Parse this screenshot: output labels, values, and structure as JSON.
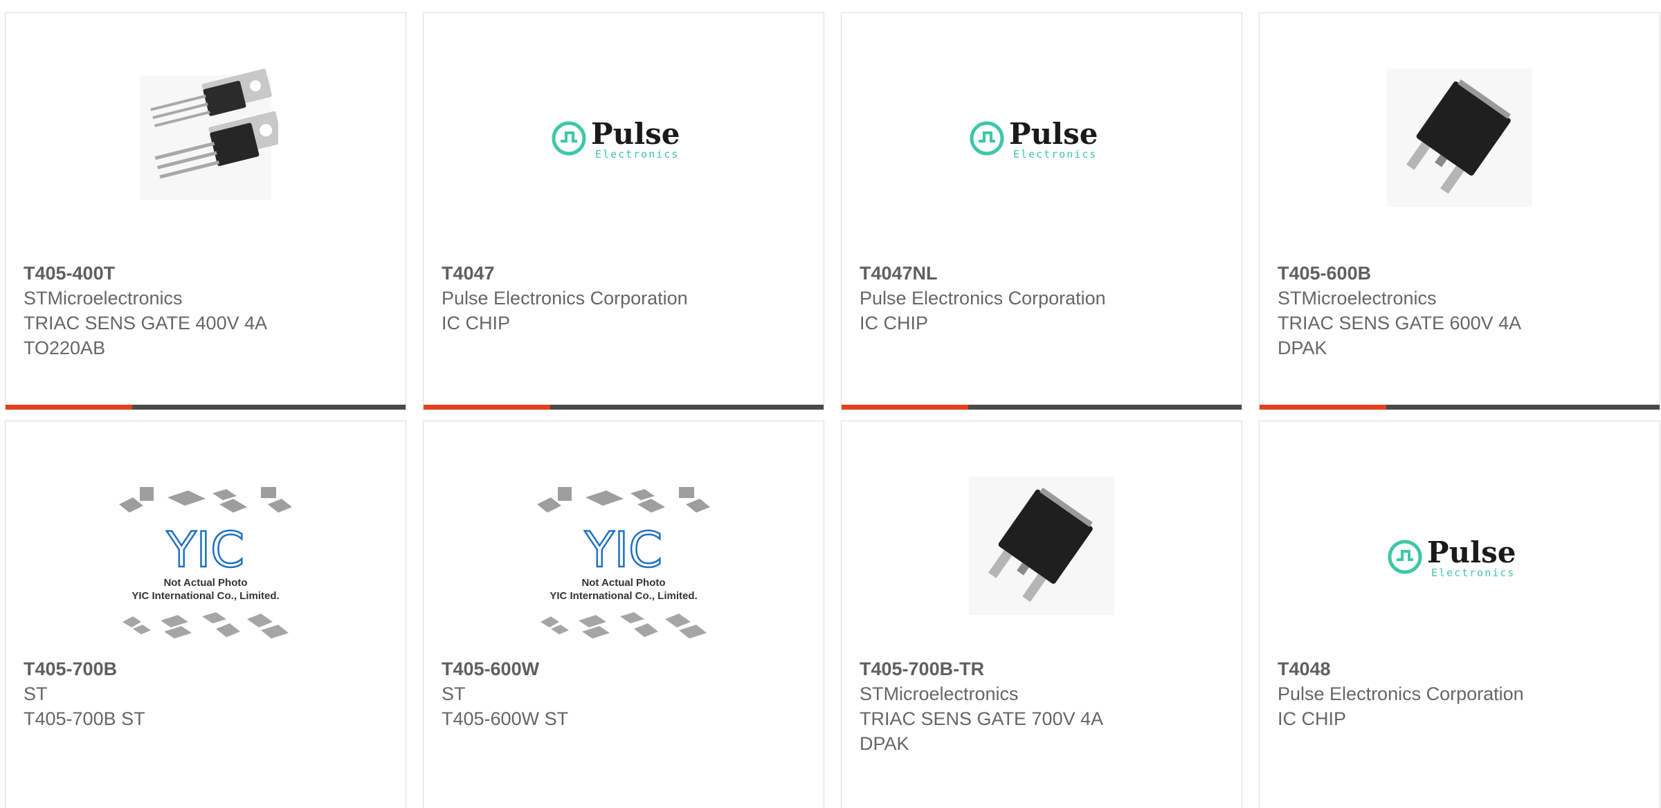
{
  "colors": {
    "accent": "#e6401e",
    "bar": "#4a4a4a",
    "text": "#666666",
    "pulse_teal": "#3cc7a8",
    "yic_blue": "#1f6fc0"
  },
  "products": [
    {
      "part": "T405-400T",
      "maker": "STMicroelectronics",
      "desc": [
        "TRIAC SENS GATE 400V 4A",
        "TO220AB"
      ],
      "image": "to220-package-icon"
    },
    {
      "part": "T4047",
      "maker": "Pulse Electronics Corporation",
      "desc": [
        "IC CHIP"
      ],
      "image": "pulse-logo"
    },
    {
      "part": "T4047NL",
      "maker": "Pulse Electronics Corporation",
      "desc": [
        "IC CHIP"
      ],
      "image": "pulse-logo"
    },
    {
      "part": "T405-600B",
      "maker": "STMicroelectronics",
      "desc": [
        "TRIAC SENS GATE 600V 4A",
        "DPAK"
      ],
      "image": "dpak-package-icon"
    },
    {
      "part": "T405-700B",
      "maker": "ST",
      "desc": [
        "T405-700B ST"
      ],
      "image": "yic-placeholder"
    },
    {
      "part": "T405-600W",
      "maker": "ST",
      "desc": [
        "T405-600W ST"
      ],
      "image": "yic-placeholder"
    },
    {
      "part": "T405-700B-TR",
      "maker": "STMicroelectronics",
      "desc": [
        "TRIAC SENS GATE 700V 4A",
        "DPAK"
      ],
      "image": "dpak-package-icon"
    },
    {
      "part": "T4048",
      "maker": "Pulse Electronics Corporation",
      "desc": [
        "IC CHIP"
      ],
      "image": "pulse-logo"
    }
  ],
  "logos": {
    "pulse_word": "Pulse",
    "pulse_sub": "Electronics",
    "yic_mark": "YIC",
    "yic_line1": "Not Actual Photo",
    "yic_line2": "YIC International Co., Limited."
  }
}
